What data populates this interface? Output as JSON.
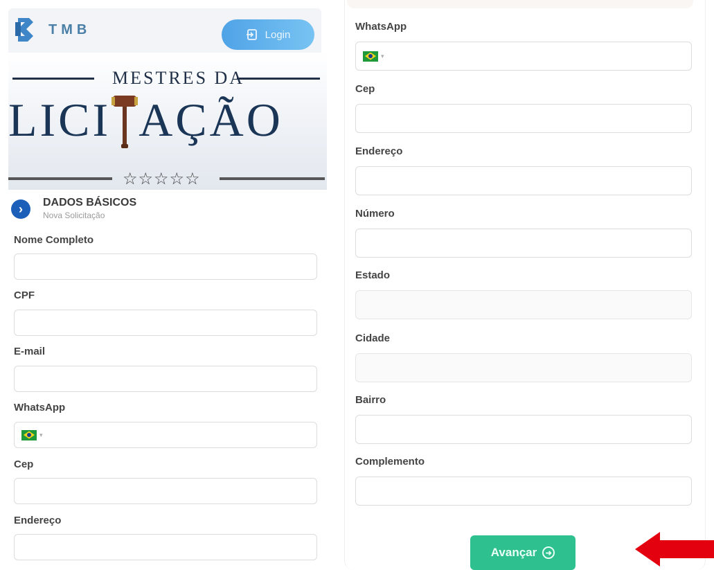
{
  "header": {
    "brand": "TMB",
    "login_label": "Login"
  },
  "banner": {
    "subtitle": "MESTRES DA",
    "title_left": "LICI",
    "title_right": "AÇÃO",
    "stars": "☆☆☆☆☆"
  },
  "section": {
    "title": "DADOS BÁSICOS",
    "subtitle": "Nova Solicitação"
  },
  "left_form": {
    "fields": [
      {
        "label": "Nome Completo",
        "value": ""
      },
      {
        "label": "CPF",
        "value": ""
      },
      {
        "label": "E-mail",
        "value": ""
      },
      {
        "label": "WhatsApp",
        "value": ""
      },
      {
        "label": "Cep",
        "value": ""
      },
      {
        "label": "Endereço",
        "value": ""
      }
    ]
  },
  "right_form": {
    "fields": [
      {
        "label": "WhatsApp",
        "value": ""
      },
      {
        "label": "Cep",
        "value": ""
      },
      {
        "label": "Endereço",
        "value": ""
      },
      {
        "label": "Número",
        "value": ""
      },
      {
        "label": "Estado",
        "value": ""
      },
      {
        "label": "Cidade",
        "value": ""
      },
      {
        "label": "Bairro",
        "value": ""
      },
      {
        "label": "Complemento",
        "value": ""
      }
    ],
    "submit_label": "Avançar"
  },
  "colors": {
    "login": "#4fa3e6",
    "submit": "#2fc08f",
    "arrow": "#e3000f",
    "chevron": "#1c5fb8",
    "banner_text": "#1a3556"
  },
  "icons": [
    "tmb-logo-icon",
    "login-icon",
    "gavel-icon",
    "chevron-right-icon",
    "brazil-flag-icon",
    "caret-down-icon",
    "arrow-right-circle-icon",
    "red-arrow-icon"
  ]
}
